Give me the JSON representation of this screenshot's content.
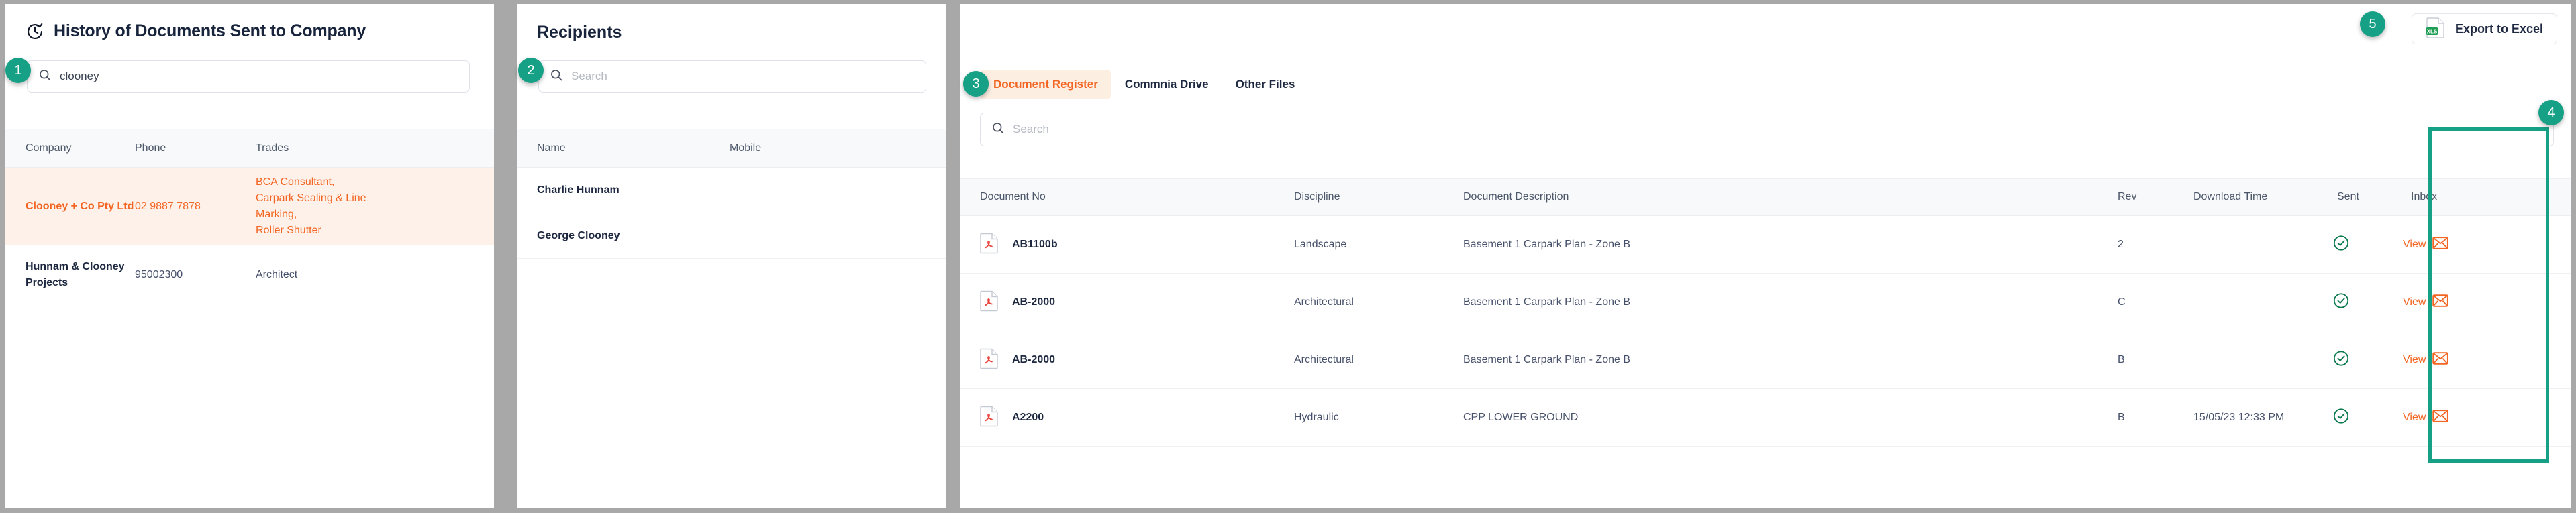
{
  "left_panel": {
    "title": "History of Documents Sent to Company",
    "icon": "history-clock-icon",
    "search": {
      "value": "clooney",
      "placeholder": "Search",
      "icon": "search-icon"
    },
    "columns": [
      "Company",
      "Phone",
      "Trades"
    ],
    "rows": [
      {
        "company": "Clooney + Co Pty Ltd",
        "phone": "02 9887 7878",
        "trades": "BCA Consultant,\nCarpark Sealing & Line Marking,\nRoller Shutter",
        "selected": true
      },
      {
        "company": "Hunnam & Clooney Projects",
        "phone": "95002300",
        "trades": "Architect",
        "selected": false
      }
    ]
  },
  "mid_panel": {
    "title": "Recipients",
    "search": {
      "value": "",
      "placeholder": "Search",
      "icon": "search-icon"
    },
    "columns": [
      "Name",
      "Mobile"
    ],
    "rows": [
      {
        "name": "Charlie Hunnam",
        "mobile": ""
      },
      {
        "name": "George Clooney",
        "mobile": ""
      }
    ]
  },
  "right_panel": {
    "tabs": [
      {
        "label": "Document Register",
        "active": true
      },
      {
        "label": "Commnia Drive",
        "active": false
      },
      {
        "label": "Other Files",
        "active": false
      }
    ],
    "search": {
      "value": "",
      "placeholder": "Search",
      "icon": "search-icon"
    },
    "export": {
      "label": "Export to Excel",
      "icon": "xls-file-icon",
      "badge_text": "XLS"
    },
    "columns": [
      "Document No",
      "Discipline",
      "Document Description",
      "Rev",
      "Download Time",
      "Sent",
      "Inbox"
    ],
    "rows": [
      {
        "document_no": "AB1100b",
        "discipline": "Landscape",
        "description": "Basement 1 Carpark Plan - Zone B",
        "rev": "2",
        "download_time": "",
        "sent": true,
        "inbox_label": "View"
      },
      {
        "document_no": "AB-2000",
        "discipline": "Architectural",
        "description": "Basement 1 Carpark Plan - Zone B",
        "rev": "C",
        "download_time": "",
        "sent": true,
        "inbox_label": "View"
      },
      {
        "document_no": "AB-2000",
        "discipline": "Architectural",
        "description": "Basement 1 Carpark Plan - Zone B",
        "rev": "B",
        "download_time": "",
        "sent": true,
        "inbox_label": "View"
      },
      {
        "document_no": "A2200",
        "discipline": "Hydraulic",
        "description": "CPP LOWER GROUND",
        "rev": "B",
        "download_time": "15/05/23 12:33 PM",
        "sent": true,
        "inbox_label": "View"
      }
    ]
  },
  "annotations": {
    "badges": [
      "1",
      "2",
      "3",
      "4",
      "5"
    ]
  },
  "colors": {
    "accent_orange": "#f26522",
    "accent_green": "#16a085",
    "check_green": "#0e7a4f",
    "selected_row_bg": "#fdf1e9",
    "header_bg": "#f7f9fb",
    "text_dark": "#1d2840"
  }
}
